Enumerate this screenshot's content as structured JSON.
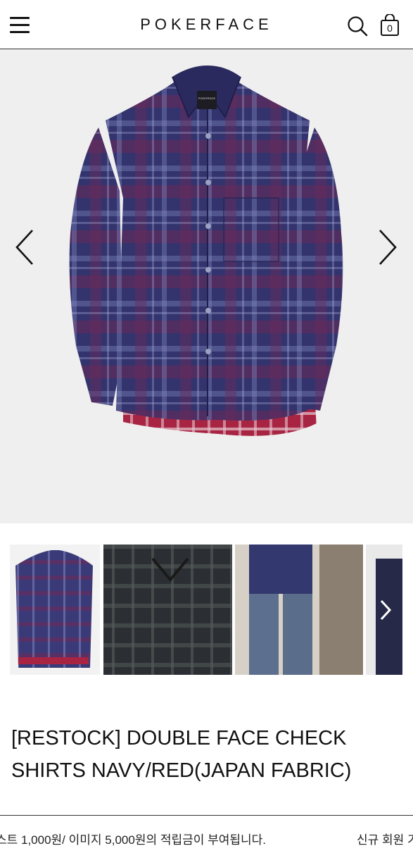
{
  "header": {
    "logo": "POKERFACE",
    "cart_count": "0"
  },
  "icons": {
    "menu": "hamburger-menu-icon",
    "search": "search-icon",
    "cart": "shopping-bag-icon",
    "prev": "chevron-left-icon",
    "next": "chevron-right-icon"
  },
  "hero": {
    "shirt_label": "POKERFACE"
  },
  "product": {
    "title_line1": "[RESTOCK] DOUBLE FACE CHECK",
    "title_line2": "SHIRTS NAVY/RED(JAPAN FABRIC)"
  },
  "notice": {
    "text": "스트 1,000원/ 이미지 5,000원의 적립금이 부여됩니다.",
    "text_2": "신규 회원 기"
  },
  "colors": {
    "navy": "#2f2f6a",
    "red": "#9a2340",
    "hero_bg": "#efefef"
  }
}
